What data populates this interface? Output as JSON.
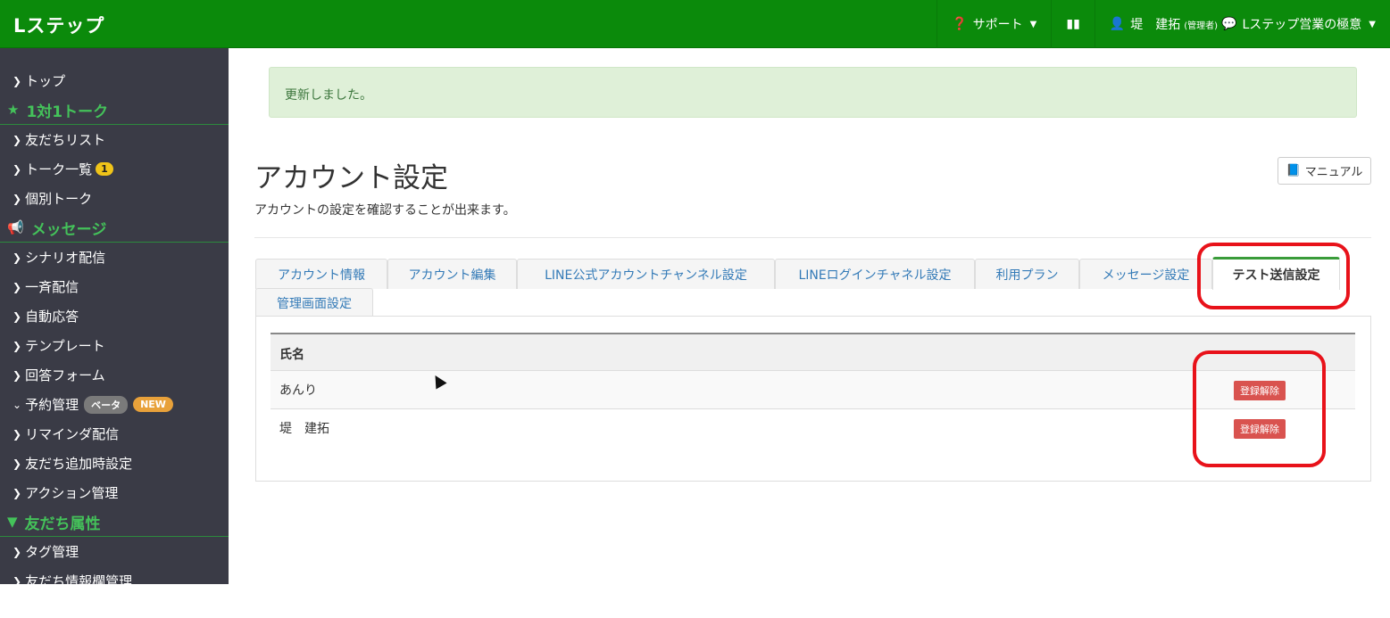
{
  "brand": "Lステップ",
  "navbar": {
    "support": "サポート",
    "user_name": "堤　建拓",
    "user_role": "(管理者)",
    "account": "Lステップ営業の極意"
  },
  "sidebar": {
    "top": "トップ",
    "sections": [
      {
        "title": "1対1トーク",
        "items": [
          "友だちリスト",
          "トーク一覧",
          "個別トーク"
        ]
      },
      {
        "title": "メッセージ",
        "items": [
          "シナリオ配信",
          "一斉配信",
          "自動応答",
          "テンプレート",
          "回答フォーム",
          "予約管理",
          "リマインダ配信",
          "友だち追加時設定",
          "アクション管理"
        ]
      },
      {
        "title": "友だち属性",
        "items": [
          "タグ管理",
          "友だち情報欄管理"
        ]
      }
    ],
    "talk_badge": "1",
    "beta_badge": "ベータ",
    "new_badge": "NEW"
  },
  "alert": "更新しました。",
  "page": {
    "title": "アカウント設定",
    "description": "アカウントの設定を確認することが出来ます。",
    "manual_button": "マニュアル"
  },
  "tabs": [
    "アカウント情報",
    "アカウント編集",
    "LINE公式アカウントチャンネル設定",
    "LINEログインチャネル設定",
    "利用プラン",
    "メッセージ設定",
    "テスト送信設定",
    "管理画面設定"
  ],
  "active_tab": "テスト送信設定",
  "table": {
    "header": "氏名",
    "rows": [
      {
        "name": "あんり",
        "action": "登録解除"
      },
      {
        "name": "堤　建拓",
        "action": "登録解除"
      }
    ]
  },
  "colors": {
    "brand_green": "#0b8a0b",
    "sidebar_bg": "#3a3b46",
    "section_green": "#44c25a",
    "danger": "#d9534f",
    "annotation_red": "#e8121a"
  }
}
